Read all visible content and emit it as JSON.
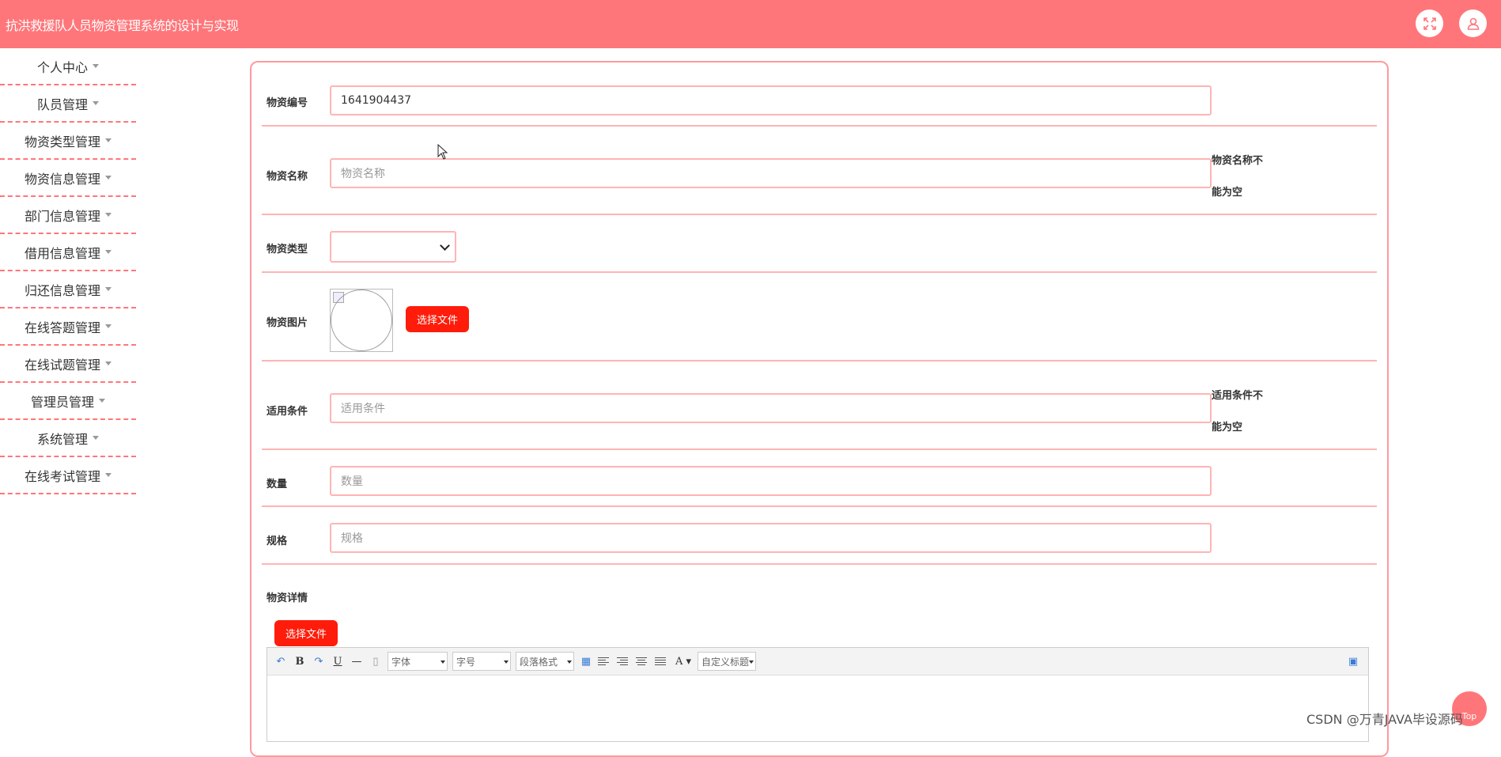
{
  "app": {
    "title": "抗洪救援队人员物资管理系统的设计与实现",
    "header_color": "#ff767a"
  },
  "sidebar": {
    "items": [
      {
        "label": "个人中心"
      },
      {
        "label": "队员管理"
      },
      {
        "label": "物资类型管理"
      },
      {
        "label": "物资信息管理"
      },
      {
        "label": "部门信息管理"
      },
      {
        "label": "借用信息管理"
      },
      {
        "label": "归还信息管理"
      },
      {
        "label": "在线答题管理"
      },
      {
        "label": "在线试题管理"
      },
      {
        "label": "管理员管理"
      },
      {
        "label": "系统管理"
      },
      {
        "label": "在线考试管理"
      }
    ]
  },
  "form": {
    "code": {
      "label": "物资编号",
      "value": "1641904437"
    },
    "name": {
      "label": "物资名称",
      "placeholder": "物资名称",
      "error_line1": "物资名称不",
      "error_line2": "能为空"
    },
    "type": {
      "label": "物资类型",
      "selected": ""
    },
    "image": {
      "label": "物资图片",
      "button": "选择文件"
    },
    "condition": {
      "label": "适用条件",
      "placeholder": "适用条件",
      "error_line1": "适用条件不",
      "error_line2": "能为空"
    },
    "quantity": {
      "label": "数量",
      "placeholder": "数量"
    },
    "spec": {
      "label": "规格",
      "placeholder": "规格"
    },
    "detail": {
      "label": "物资详情",
      "button": "选择文件"
    }
  },
  "editor": {
    "font_select": "字体",
    "size_select": "字号",
    "paragraph_select": "段落格式",
    "custom_title_select": "自定义标题"
  },
  "back_to_top": "Top",
  "watermark": "CSDN @万青JAVA毕设源码"
}
